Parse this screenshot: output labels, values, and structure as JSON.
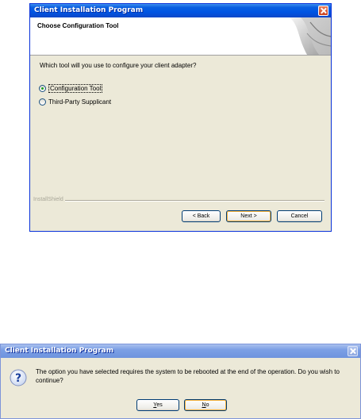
{
  "installer": {
    "title": "Client Installation Program",
    "header_title": "Choose Configuration Tool",
    "question": "Which tool will you use to configure your client adapter?",
    "options": [
      {
        "label": "Configuration Tool",
        "selected": true
      },
      {
        "label": "Third-Party Supplicant",
        "selected": false
      }
    ],
    "brand": "InstallShield",
    "buttons": {
      "back": "< Back",
      "next": "Next >",
      "cancel": "Cancel"
    }
  },
  "dialog": {
    "title": "Client Installation Program",
    "icon": "question-icon",
    "message": "The option you have selected requires the system to be rebooted at the end of the operation. Do you wish to continue?",
    "buttons": {
      "yes": "Yes",
      "no": "No"
    }
  },
  "colors": {
    "titlebar": "#0054e3",
    "window_bg": "#ece9d8",
    "button_border": "#003c74",
    "default_button_ring": "#f8b33b"
  }
}
